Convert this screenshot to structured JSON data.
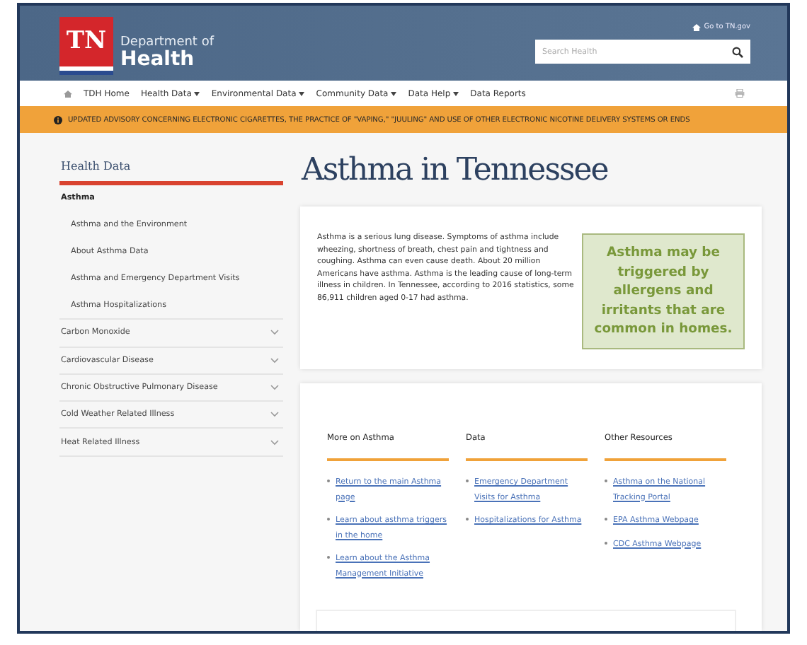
{
  "header": {
    "logo": "TN",
    "department_line1": "Department of",
    "department_line2": "Health",
    "gov_link": "Go to TN.gov",
    "search": {
      "placeholder": "Search Health"
    }
  },
  "nav": {
    "items": [
      {
        "label": "TDH Home",
        "dropdown": false
      },
      {
        "label": "Health Data",
        "dropdown": true
      },
      {
        "label": "Environmental Data",
        "dropdown": true
      },
      {
        "label": "Community Data",
        "dropdown": true
      },
      {
        "label": "Data Help",
        "dropdown": true
      },
      {
        "label": "Data Reports",
        "dropdown": false
      }
    ]
  },
  "alert": "UPDATED ADVISORY CONCERNING ELECTRONIC CIGARETTES, THE PRACTICE OF \"VAPING,\" \"JUULING\" AND USE OF OTHER ELECTRONIC NICOTINE DELIVERY SYSTEMS OR ENDS",
  "sidebar": {
    "title": "Health Data",
    "items": [
      {
        "label": "Asthma",
        "expanded": true,
        "children": [
          {
            "label": "Asthma and the Environment"
          },
          {
            "label": "About Asthma Data"
          },
          {
            "label": "Asthma and Emergency Department Visits"
          },
          {
            "label": "Asthma Hospitalizations"
          }
        ]
      },
      {
        "label": "Carbon Monoxide",
        "expanded": false
      },
      {
        "label": "Cardiovascular Disease",
        "expanded": false
      },
      {
        "label": "Chronic Obstructive Pulmonary Disease",
        "expanded": false
      },
      {
        "label": "Cold Weather Related Illness",
        "expanded": false
      },
      {
        "label": "Heat Related Illness",
        "expanded": false
      }
    ]
  },
  "page_title": "Asthma in Tennessee",
  "intro": {
    "text": "Asthma is a serious lung disease. Symptoms of asthma include wheezing, shortness of breath, chest pain and tightness and coughing. Asthma can even cause death.  About 20 million Americans have asthma. Asthma is the leading cause of long-term illness in children.  In Tennessee, according to 2016 statistics, some 86,911 children aged 0-17 had asthma.",
    "callout": "Asthma may be triggered by allergens and irritants that are common in homes."
  },
  "link_columns": [
    {
      "heading": "More on Asthma",
      "links": [
        "Return to the main Asthma page",
        "Learn about asthma triggers in the home",
        "Learn about the Asthma Management Initiative"
      ]
    },
    {
      "heading": "Data",
      "links": [
        "Emergency Department Visits for Asthma",
        "Hospitalizations for Asthma"
      ]
    },
    {
      "heading": "Other Resources",
      "links": [
        "Asthma on the National Tracking Portal",
        "EPA Asthma Webpage",
        "CDC Asthma Webpage"
      ]
    }
  ]
}
